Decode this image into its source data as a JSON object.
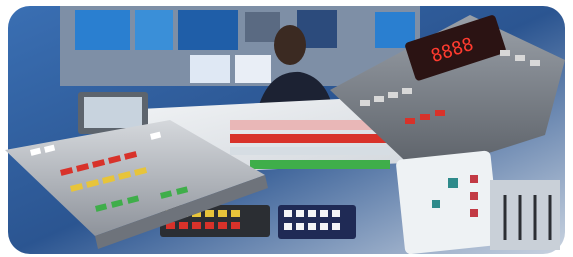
{
  "scene": {
    "description_free": true,
    "panel_display_text": "8888",
    "colors": {
      "background_blue": "#2f5d9c",
      "console_grey": "#b9bcc2",
      "console_dark": "#6e737b",
      "led_red": "#d8322a",
      "led_green": "#3fae4a",
      "led_yellow": "#e7c43a",
      "monitor_blue": "#2a7fd0"
    },
    "icons": [
      "monitor-wall",
      "operator",
      "switcher-console-left",
      "switcher-console-right",
      "control-panel-center",
      "fader-bank",
      "touch-panel"
    ]
  }
}
